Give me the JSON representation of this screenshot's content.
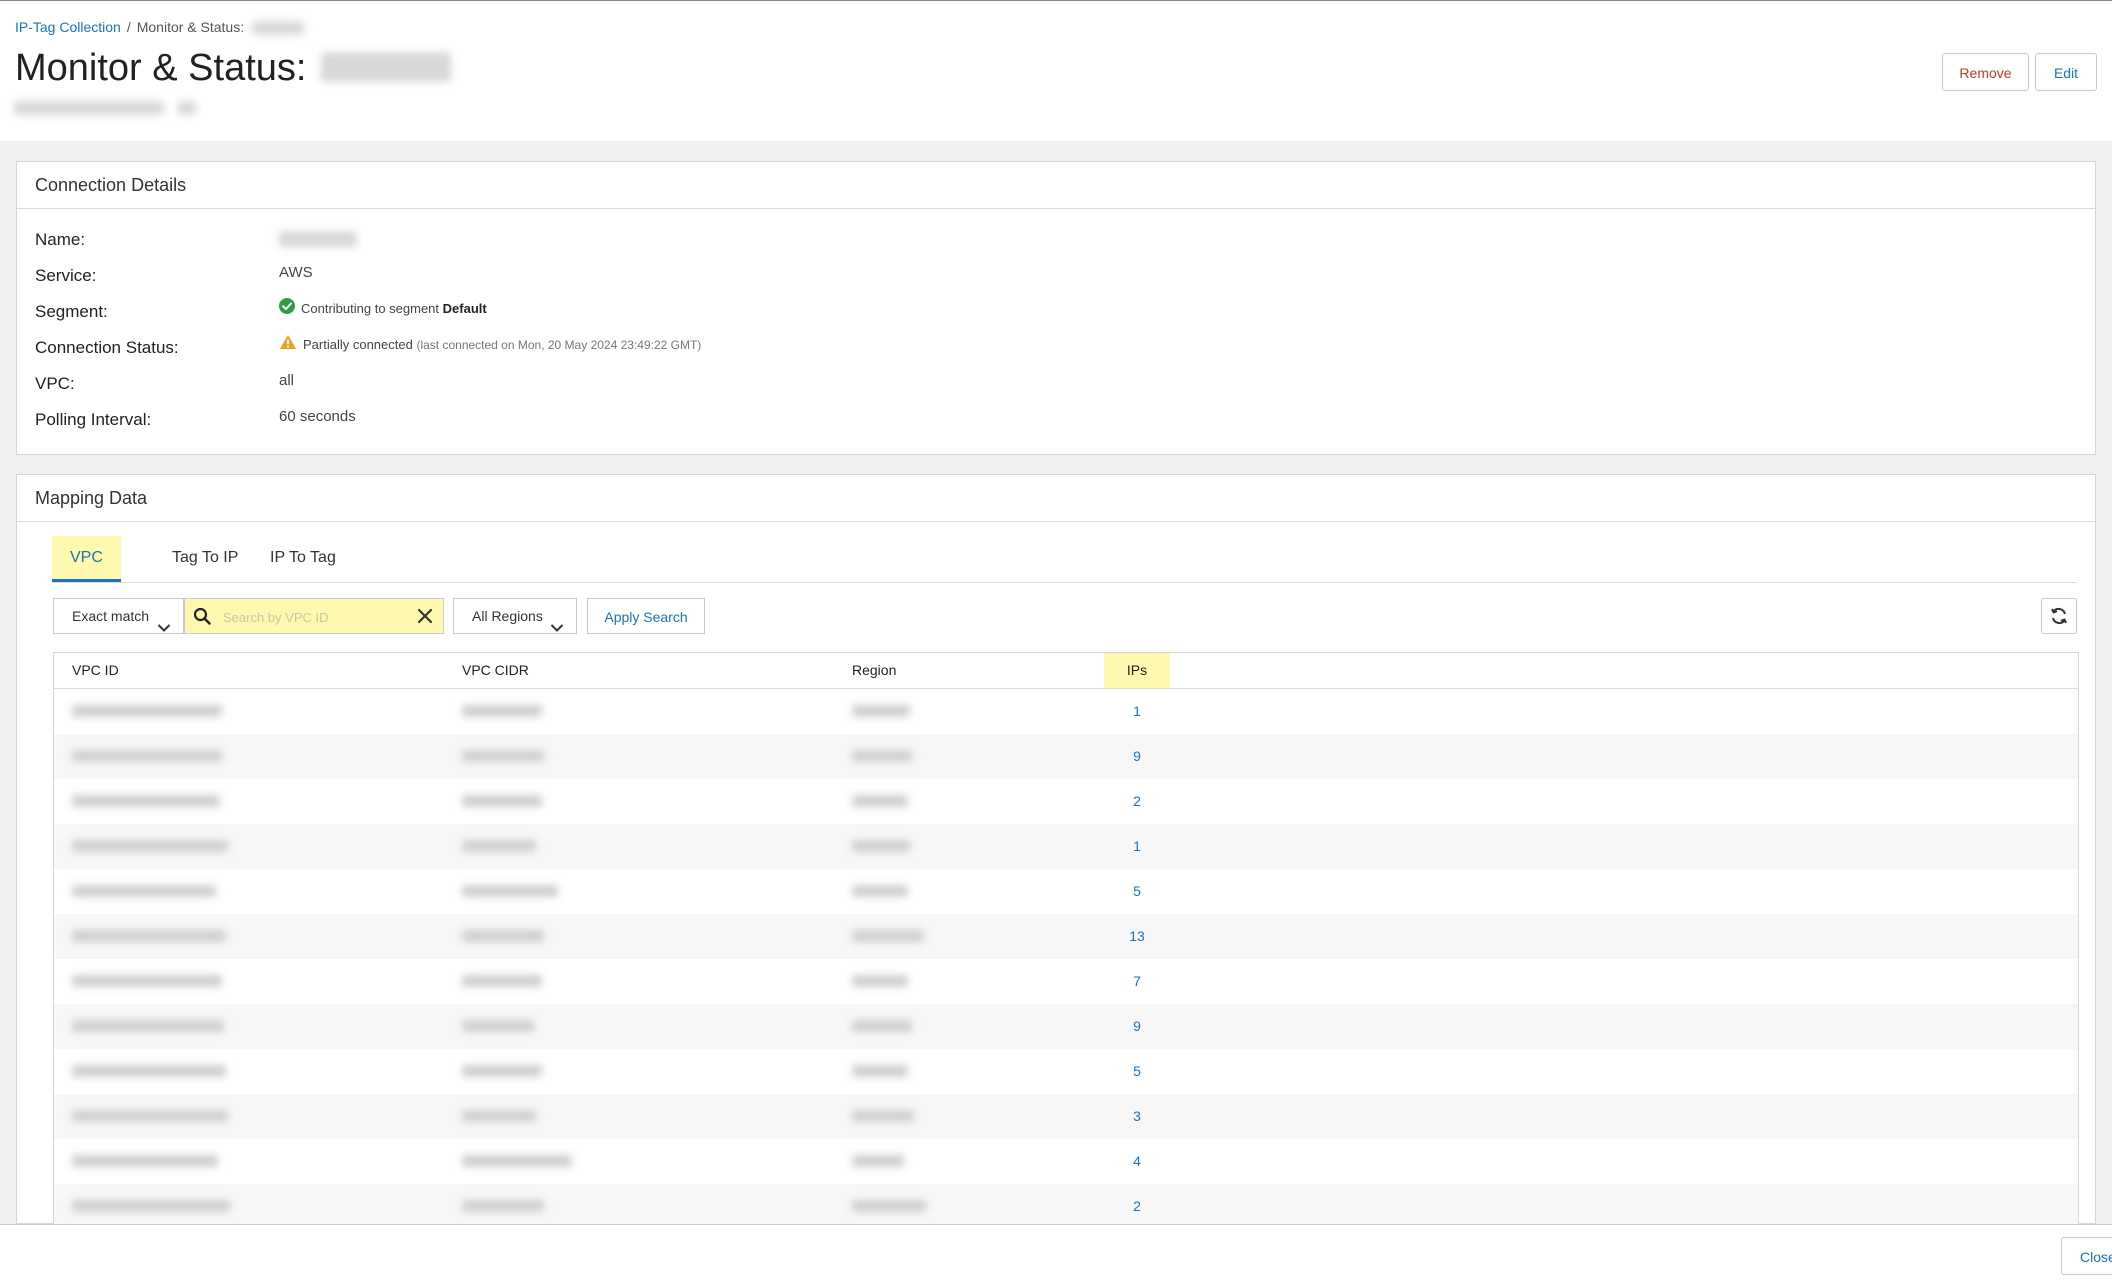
{
  "breadcrumb": {
    "parent": "IP-Tag Collection",
    "separator": "/",
    "current": "Monitor & Status:"
  },
  "page_title": "Monitor & Status:",
  "actions": {
    "remove_label": "Remove",
    "edit_label": "Edit"
  },
  "connection_details": {
    "title": "Connection Details",
    "labels": {
      "name": "Name:",
      "service": "Service:",
      "segment": "Segment:",
      "connection_status": "Connection Status:",
      "vpc": "VPC:",
      "polling_interval": "Polling Interval:"
    },
    "service": "AWS",
    "segment_text": "Contributing to segment",
    "segment_name": "Default",
    "status_text": "Partially connected",
    "status_detail": "(last connected on Mon, 20 May 2024 23:49:22 GMT)",
    "vpc": "all",
    "polling_interval": "60 seconds",
    "status_colors": {
      "success": "#2e9e44",
      "warning": "#f0a11b"
    }
  },
  "mapping": {
    "title": "Mapping Data",
    "tabs": [
      {
        "label": "VPC"
      },
      {
        "label": "Tag To IP"
      },
      {
        "label": "IP To Tag"
      }
    ],
    "match_label": "Exact match",
    "search_placeholder": "Search by VPC ID",
    "region_label": "All Regions",
    "apply_label": "Apply Search",
    "columns": {
      "vpc_id": "VPC ID",
      "vpc_cidr": "VPC CIDR",
      "region": "Region",
      "ips": "IPs"
    },
    "rows": [
      {
        "ips": "1"
      },
      {
        "ips": "9"
      },
      {
        "ips": "2"
      },
      {
        "ips": "1"
      },
      {
        "ips": "5"
      },
      {
        "ips": "13"
      },
      {
        "ips": "7"
      },
      {
        "ips": "9"
      },
      {
        "ips": "5"
      },
      {
        "ips": "3"
      },
      {
        "ips": "4"
      },
      {
        "ips": "2"
      }
    ]
  },
  "footer": {
    "close_label": "Close"
  },
  "colors": {
    "accent": "#1a73b8",
    "danger": "#c0392b",
    "highlight": "#fff9b0"
  }
}
